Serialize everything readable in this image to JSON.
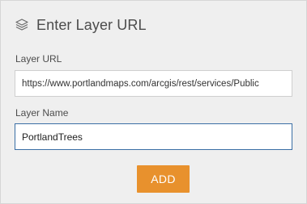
{
  "header": {
    "icon": "layers-icon",
    "title": "Enter Layer URL"
  },
  "form": {
    "url_label": "Layer URL",
    "url_value": "https://www.portlandmaps.com/arcgis/rest/services/Public",
    "name_label": "Layer Name",
    "name_value": "PortlandTrees",
    "add_label": "ADD"
  },
  "colors": {
    "accent": "#e8912d",
    "panel_bg": "#efefef",
    "focus_border": "#3a6ea5"
  }
}
